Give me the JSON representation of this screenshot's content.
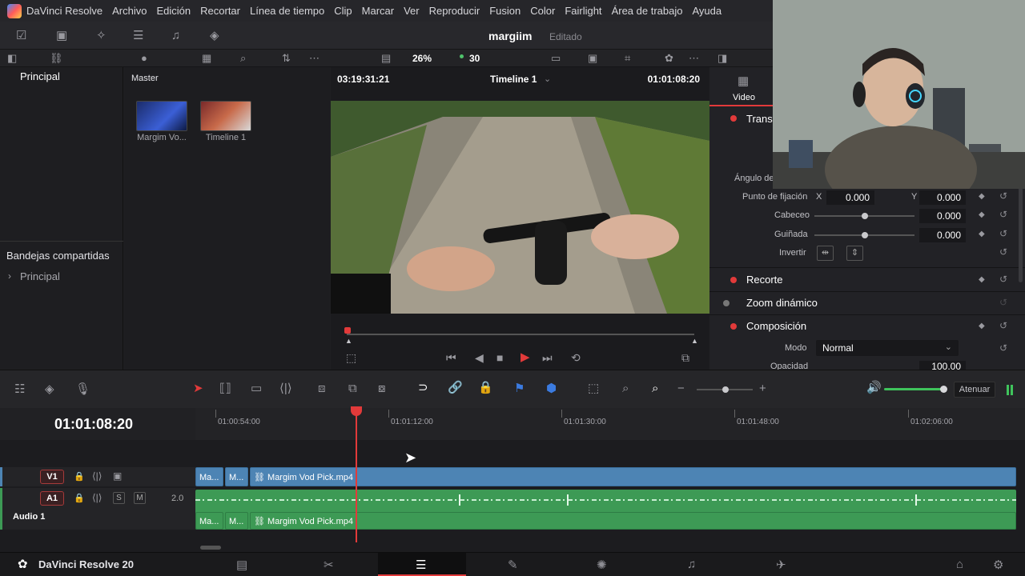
{
  "menu": {
    "items": [
      "DaVinci Resolve",
      "Archivo",
      "Edición",
      "Recortar",
      "Línea de tiempo",
      "Clip",
      "Marcar",
      "Ver",
      "Reproducir",
      "Fusion",
      "Color",
      "Fairlight",
      "Área de trabajo",
      "Ayuda"
    ]
  },
  "project": {
    "name": "margiim",
    "state": "Editado"
  },
  "toolbar": {
    "zoom": "26%",
    "fps": "30"
  },
  "left_panel": {
    "title": "Principal",
    "shared_title": "Bandejas compartidas",
    "shared_item": "Principal"
  },
  "media": {
    "title": "Master",
    "items": [
      {
        "label": "Margim Vo..."
      },
      {
        "label": "Timeline 1"
      }
    ]
  },
  "viewer": {
    "source_tc": "03:19:31:21",
    "timeline_name": "Timeline 1",
    "record_tc": "01:01:08:20"
  },
  "inspector": {
    "tab": "Video",
    "transform_label": "Transf",
    "angle_label": "Ángulo de",
    "pivot_label": "Punto de fijación",
    "pivot_x_label": "X",
    "pivot_x": "0.000",
    "pivot_y_label": "Y",
    "pivot_y": "0.000",
    "pitch_label": "Cabeceo",
    "pitch": "0.000",
    "yaw_label": "Guiñada",
    "yaw": "0.000",
    "flip_label": "Invertir",
    "crop_label": "Recorte",
    "dynzoom_label": "Zoom dinámico",
    "composite_label": "Composición",
    "mode_label": "Modo",
    "mode_value": "Normal",
    "opacity_label": "Opacidad",
    "opacity": "100.00"
  },
  "timeline": {
    "timecode": "01:01:08:20",
    "ruler": [
      "01:00:54:00",
      "01:01:12:00",
      "01:01:30:00",
      "01:01:48:00",
      "01:02:06:00"
    ],
    "attenuate": "Atenuar",
    "v1": "V1",
    "a1": "A1",
    "a1_channels": "2.0",
    "audio_name": "Audio 1",
    "solo": "S",
    "mute": "M",
    "clip_short1": "Ma...",
    "clip_short2": "M...",
    "clip_main": "Margim Vod Pick.mp4",
    "playhead_fraction": 0.27
  },
  "pagebar": {
    "app": "DaVinci Resolve 20"
  },
  "colors": {
    "accent_red": "#e23a3a",
    "video_clip": "#4d84b4",
    "audio_clip": "#3d9a55"
  }
}
